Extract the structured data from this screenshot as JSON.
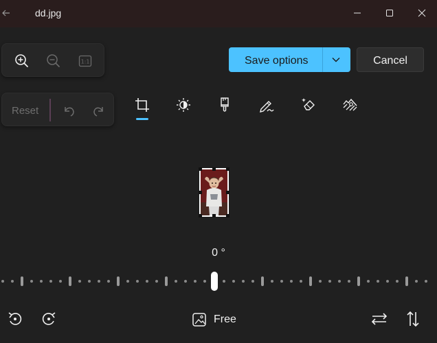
{
  "window": {
    "title": "dd.jpg"
  },
  "zoom_controls": {
    "fit_label": "1:1"
  },
  "history": {
    "reset_label": "Reset"
  },
  "actions": {
    "save_label": "Save options",
    "cancel_label": "Cancel"
  },
  "tools": [
    {
      "name": "crop",
      "icon": "crop-icon",
      "selected": true
    },
    {
      "name": "adjustment",
      "icon": "brightness-icon"
    },
    {
      "name": "filter",
      "icon": "brush-icon"
    },
    {
      "name": "markup",
      "icon": "pen-icon"
    },
    {
      "name": "erase",
      "icon": "eraser-icon"
    },
    {
      "name": "background",
      "icon": "background-blur-icon"
    }
  ],
  "straighten": {
    "angle_label": "0 °",
    "angle_value": 0
  },
  "aspect": {
    "label": "Free"
  },
  "colors": {
    "accent": "#4cc2ff",
    "background": "#202020",
    "titlebar": "#2a1d1d",
    "panel": "#262626",
    "selection_divider": "#5b3f55"
  }
}
